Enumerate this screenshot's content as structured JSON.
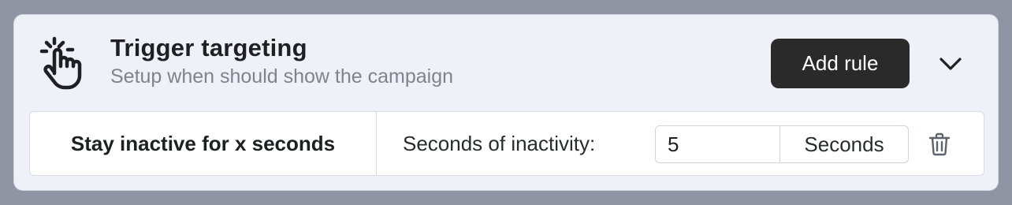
{
  "header": {
    "icon": "hand-pointer-click-icon",
    "title": "Trigger targeting",
    "subtitle": "Setup when should show the campaign",
    "add_rule_label": "Add rule",
    "collapse_icon": "chevron-down-icon"
  },
  "rule": {
    "name": "Stay inactive for x seconds",
    "field_label": "Seconds of inactivity:",
    "value": "5",
    "unit": "Seconds",
    "delete_icon": "trash-icon"
  },
  "colors": {
    "background": "#9095a3",
    "panel": "#eef1f7",
    "button": "#2a2a2b",
    "text": "#1f2023",
    "muted_text": "#7e838d"
  }
}
